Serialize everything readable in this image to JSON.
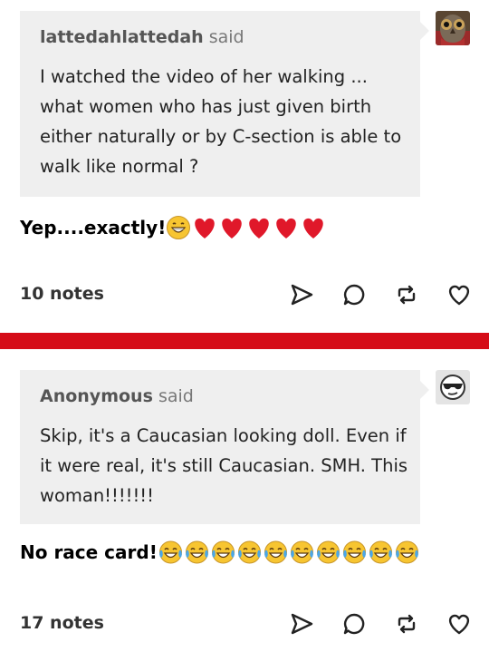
{
  "posts": [
    {
      "asker_name": "lattedahlattedah",
      "asker_said": "said",
      "avatar": "owl-avatar-icon",
      "question": "I watched the video of her walking ... what women who has just given birth either naturally or by C-section is able to walk like normal ?",
      "answer_text": "Yep....exactly!",
      "answer_emojis": [
        "grinning-face-icon",
        "red-heart-icon",
        "red-heart-icon",
        "red-heart-icon",
        "red-heart-icon",
        "red-heart-icon"
      ],
      "notes": "10 notes",
      "actions": [
        "share-icon",
        "reply-icon",
        "reblog-icon",
        "like-icon"
      ]
    },
    {
      "asker_name": "Anonymous",
      "asker_said": "said",
      "avatar": "anonymous-sunglasses-avatar-icon",
      "question": "Skip, it's a Caucasian looking doll. Even if it were real, it's still Caucasian. SMH. This woman!!!!!!!",
      "answer_text": "No race card!",
      "answer_emojis": [
        "tears-of-joy-icon",
        "tears-of-joy-icon",
        "tears-of-joy-icon",
        "tears-of-joy-icon",
        "tears-of-joy-icon",
        "tears-of-joy-icon",
        "tears-of-joy-icon",
        "tears-of-joy-icon",
        "tears-of-joy-icon",
        "tears-of-joy-icon"
      ],
      "notes": "17 notes",
      "actions": [
        "share-icon",
        "reply-icon",
        "reblog-icon",
        "like-icon"
      ]
    }
  ],
  "colors": {
    "divider": "#d50c17",
    "bubble": "#efefef",
    "heart": "#e0182a",
    "emoji_yellow": "#f7c531"
  }
}
